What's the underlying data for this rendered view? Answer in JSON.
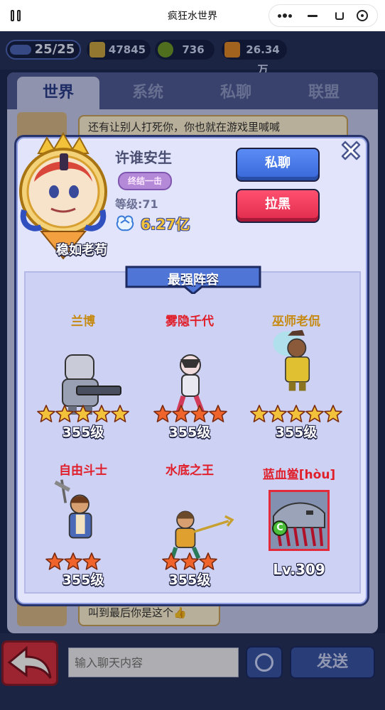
{
  "navbar": {
    "title": "疯狂水世界"
  },
  "resources": {
    "stage": "25/25",
    "gold": "47845",
    "coin": "736",
    "gift": "26.34万"
  },
  "tabs": [
    {
      "label": "世界",
      "active": true
    },
    {
      "label": "系统",
      "active": false
    },
    {
      "label": "私聊",
      "active": false
    },
    {
      "label": "联盟",
      "active": false
    }
  ],
  "chat": {
    "message_top": "还有让别人打死你，你也就在游戏里喊喊",
    "message_bottom": "叫到最后你是这个👍",
    "input_placeholder": "输入聊天内容",
    "send_label": "发送"
  },
  "profile": {
    "nickname": "稳如老苟",
    "player_name": "许谁安生",
    "title_badge": "终结一击",
    "level": "等级:71",
    "power": "6.27亿",
    "chat_button": "私聊",
    "block_button": "拉黑"
  },
  "lineup": {
    "title": "最强阵容",
    "heroes": [
      {
        "name": "兰博",
        "name_color": "#c68a12",
        "level": "355级",
        "stars": 5,
        "star_color": "#f2c23a"
      },
      {
        "name": "雾隐千代",
        "name_color": "#e01f2b",
        "level": "355级",
        "stars": 4,
        "star_color": "#f0642c"
      },
      {
        "name": "巫师老侃",
        "name_color": "#c68a12",
        "level": "355级",
        "stars": 5,
        "star_color": "#f2c23a"
      },
      {
        "name": "自由斗士",
        "name_color": "#e01f2b",
        "level": "355级",
        "stars": 3,
        "star_color": "#f0642c"
      },
      {
        "name": "水底之王",
        "name_color": "#e01f2b",
        "level": "355级",
        "stars": 3,
        "star_color": "#f0642c"
      }
    ],
    "pet": {
      "name": "蓝血鲎[hòu]",
      "name_color": "#e01f2b",
      "grade": "C",
      "level": "Lv.309"
    }
  }
}
